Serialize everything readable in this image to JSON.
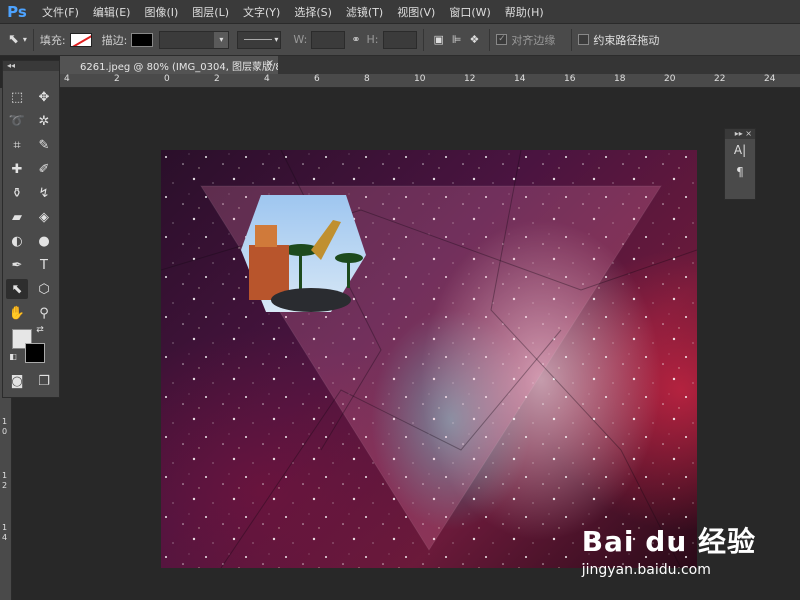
{
  "app": {
    "logo": "Ps"
  },
  "menu": [
    "文件(F)",
    "编辑(E)",
    "图像(I)",
    "图层(L)",
    "文字(Y)",
    "选择(S)",
    "滤镜(T)",
    "视图(V)",
    "窗口(W)",
    "帮助(H)"
  ],
  "options": {
    "fill_label": "填充:",
    "stroke_label": "描边:",
    "w_label": "W:",
    "h_label": "H:",
    "align_edges_label": "对齐边缘",
    "constrain_path_label": "约束路径拖动"
  },
  "document": {
    "tab_title": "6261.jpeg @ 80% (IMG_0304, 图层蒙版/8) *",
    "tab_close": "×"
  },
  "ruler_top_ticks": [
    "4",
    "2",
    "0",
    "2",
    "4",
    "6",
    "8",
    "10",
    "12",
    "14",
    "16",
    "18",
    "20",
    "22",
    "24"
  ],
  "ruler_left_ticks": [
    "1",
    "0",
    "1",
    "2",
    "1",
    "4"
  ],
  "right_panel": {
    "char_icon": "A|",
    "para_icon": "¶"
  },
  "watermark": {
    "brand": "Bai du 经验",
    "url": "jingyan.baidu.com"
  },
  "colors": {
    "foreground": "#e6e6e6",
    "background": "#000000",
    "accent": "#4da3ff"
  }
}
